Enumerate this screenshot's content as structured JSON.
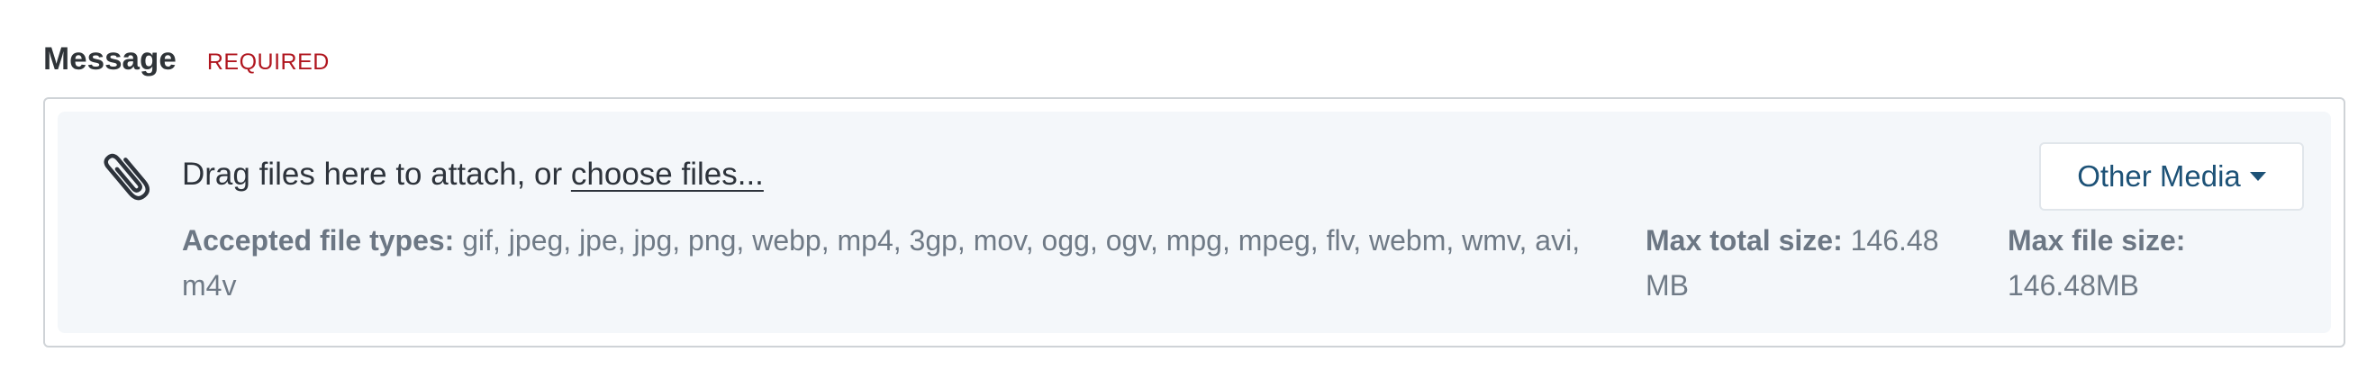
{
  "field": {
    "title": "Message",
    "required_label": "REQUIRED"
  },
  "upload": {
    "icon": "paperclip-icon",
    "drop_text": "Drag files here to attach, or ",
    "choose_link": "choose files...",
    "accepted_label": "Accepted file types:",
    "accepted_types": " gif, jpeg, jpe, jpg, png, webp, mp4, 3gp, mov, ogg, ogv, mpg, mpeg, flv, webm, wmv, avi, m4v",
    "max_total_label": "Max total size:",
    "max_total_value": " 146.48 MB",
    "max_file_label": "Max file size:",
    "max_file_value": " 146.48MB",
    "media_button_label": "Other Media",
    "media_button_icon": "caret-down-icon"
  },
  "colors": {
    "required": "#b0161f",
    "dropzone_bg": "#f4f7fa",
    "button_text": "#1d5277"
  }
}
